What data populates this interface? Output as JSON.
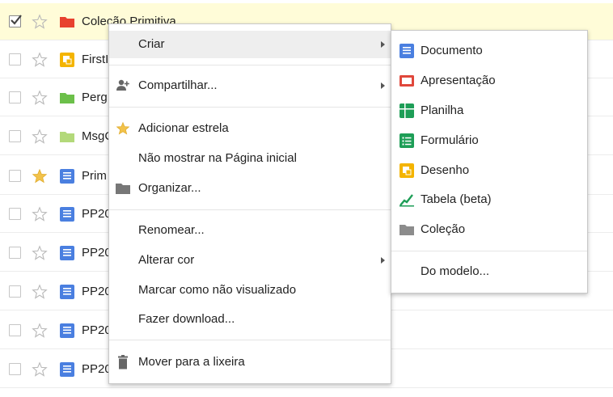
{
  "files": [
    {
      "name": "Coleção Primitiva",
      "icon": "folder-red-icon",
      "checked": true,
      "starred": false,
      "selected": true
    },
    {
      "name": "FirstI",
      "icon": "drawing-icon",
      "checked": false,
      "starred": false
    },
    {
      "name": "Perg",
      "icon": "folder-green-icon",
      "checked": false,
      "starred": false
    },
    {
      "name": "MsgC",
      "icon": "folder-lightgreen-icon",
      "checked": false,
      "starred": false
    },
    {
      "name": "Prim",
      "icon": "document-icon",
      "checked": false,
      "starred": true
    },
    {
      "name": "PP20",
      "icon": "document-icon",
      "checked": false,
      "starred": false
    },
    {
      "name": "PP20",
      "icon": "document-icon",
      "checked": false,
      "starred": false
    },
    {
      "name": "PP20",
      "icon": "document-icon",
      "checked": false,
      "starred": false
    },
    {
      "name": "PP20",
      "icon": "document-icon",
      "checked": false,
      "starred": false
    },
    {
      "name": "PP20",
      "icon": "document-icon",
      "checked": false,
      "starred": false
    }
  ],
  "context_menu": {
    "create": "Criar",
    "share": "Compartilhar...",
    "add_star": "Adicionar estrela",
    "hide_home": "Não mostrar na Página inicial",
    "organize": "Organizar...",
    "rename": "Renomear...",
    "change_color": "Alterar cor",
    "mark_unviewed": "Marcar como não visualizado",
    "download": "Fazer download...",
    "trash": "Mover para a lixeira"
  },
  "create_submenu": {
    "document": "Documento",
    "presentation": "Apresentação",
    "spreadsheet": "Planilha",
    "form": "Formulário",
    "drawing": "Desenho",
    "table": "Tabela (beta)",
    "collection": "Coleção",
    "from_template": "Do modelo..."
  },
  "colors": {
    "selected_row": "#fffcd8",
    "doc_blue": "#4a7fe0",
    "slides_red": "#e0473b",
    "sheets_green": "#1e9e57",
    "drawing_yellow": "#f4b400",
    "folder_gray": "#8c8c8c",
    "star_gold": "#f2c24a"
  }
}
